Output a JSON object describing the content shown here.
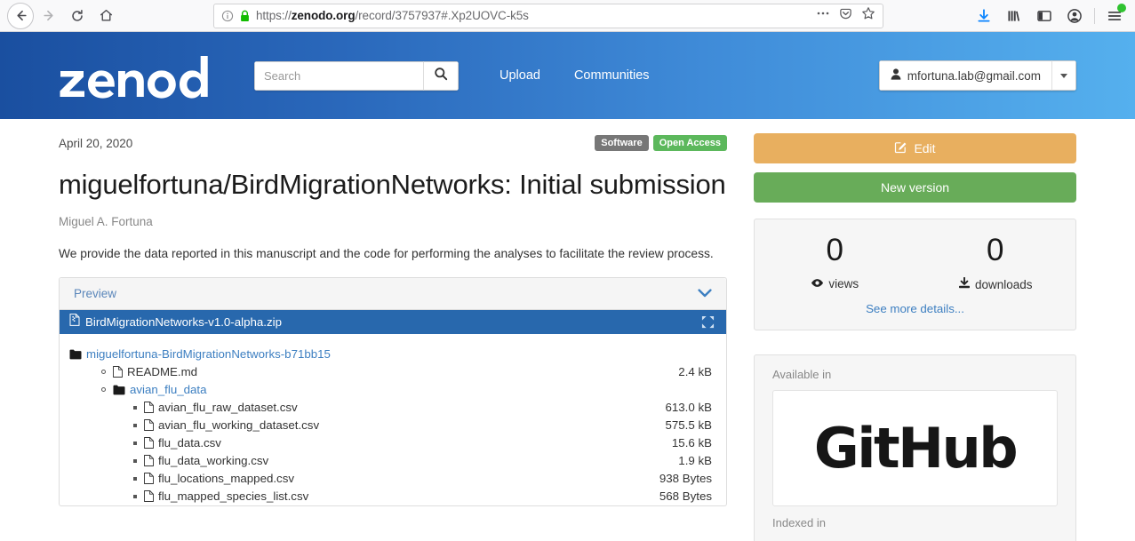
{
  "browser": {
    "url_prefix": "https://",
    "url_domain": "zenodo.org",
    "url_path": "/record/3757937#.Xp2UOVC-k5s",
    "back_icon": "back-arrow-icon",
    "forward_icon": "forward-arrow-icon",
    "reload_icon": "reload-icon",
    "home_icon": "home-icon",
    "info_icon": "site-info-icon",
    "lock_icon": "padlock-icon",
    "page_actions_icon": "ellipsis-icon",
    "pocket_icon": "pocket-icon",
    "bookmark_icon": "star-icon",
    "downloads_icon": "downloads-icon",
    "library_icon": "library-icon",
    "sidebar_icon": "sidebar-icon",
    "account_icon": "account-icon",
    "menu_icon": "hamburger-menu-icon"
  },
  "header": {
    "logo_text": "zenodo",
    "search_placeholder": "Search",
    "search_value": "",
    "search_icon": "magnifier-icon",
    "nav": [
      {
        "label": "Upload"
      },
      {
        "label": "Communities"
      }
    ],
    "user": {
      "email": "mfortuna.lab@gmail.com",
      "user_icon": "person-icon",
      "caret_icon": "chevron-down-icon"
    }
  },
  "record": {
    "publication_date": "April 20, 2020",
    "badges": [
      {
        "label": "Software",
        "color": "#777777"
      },
      {
        "label": "Open Access",
        "color": "#5cb85c"
      }
    ],
    "title": "miguelfortuna/BirdMigrationNetworks: Initial submission",
    "authors": "Miguel A. Fortuna",
    "description": "We provide the data reported in this manuscript and the code for performing the analyses to facilitate the review process."
  },
  "preview": {
    "heading": "Preview",
    "collapse_icon": "chevron-down-icon",
    "zip_file": "BirdMigrationNetworks-v1.0-alpha.zip",
    "zip_icon": "archive-file-icon",
    "expand_icon": "fullscreen-expand-icon",
    "tree": [
      {
        "name": "miguelfortuna-BirdMigrationNetworks-b71bb15",
        "size": "",
        "kind": "folder",
        "depth": 0,
        "link": true
      },
      {
        "name": "README.md",
        "size": "2.4 kB",
        "kind": "file",
        "depth": 1,
        "link": false
      },
      {
        "name": "avian_flu_data",
        "size": "",
        "kind": "folder",
        "depth": 1,
        "link": true
      },
      {
        "name": "avian_flu_raw_dataset.csv",
        "size": "613.0 kB",
        "kind": "file",
        "depth": 2,
        "link": false
      },
      {
        "name": "avian_flu_working_dataset.csv",
        "size": "575.5 kB",
        "kind": "file",
        "depth": 2,
        "link": false
      },
      {
        "name": "flu_data.csv",
        "size": "15.6 kB",
        "kind": "file",
        "depth": 2,
        "link": false
      },
      {
        "name": "flu_data_working.csv",
        "size": "1.9 kB",
        "kind": "file",
        "depth": 2,
        "link": false
      },
      {
        "name": "flu_locations_mapped.csv",
        "size": "938 Bytes",
        "kind": "file",
        "depth": 2,
        "link": false
      },
      {
        "name": "flu_mapped_species_list.csv",
        "size": "568 Bytes",
        "kind": "file",
        "depth": 2,
        "link": false
      }
    ]
  },
  "sidebar": {
    "edit_label": "Edit",
    "edit_icon": "pencil-square-icon",
    "edit_color": "#e8af5f",
    "new_version_label": "New version",
    "new_version_color": "#68ac59",
    "stats": {
      "views_value": "0",
      "views_label": "views",
      "views_icon": "eye-icon",
      "downloads_value": "0",
      "downloads_label": "downloads",
      "downloads_icon": "download-icon",
      "see_more_label": "See more details..."
    },
    "available_in_label": "Available in",
    "github_label": "GitHub",
    "indexed_in_label": "Indexed in"
  }
}
